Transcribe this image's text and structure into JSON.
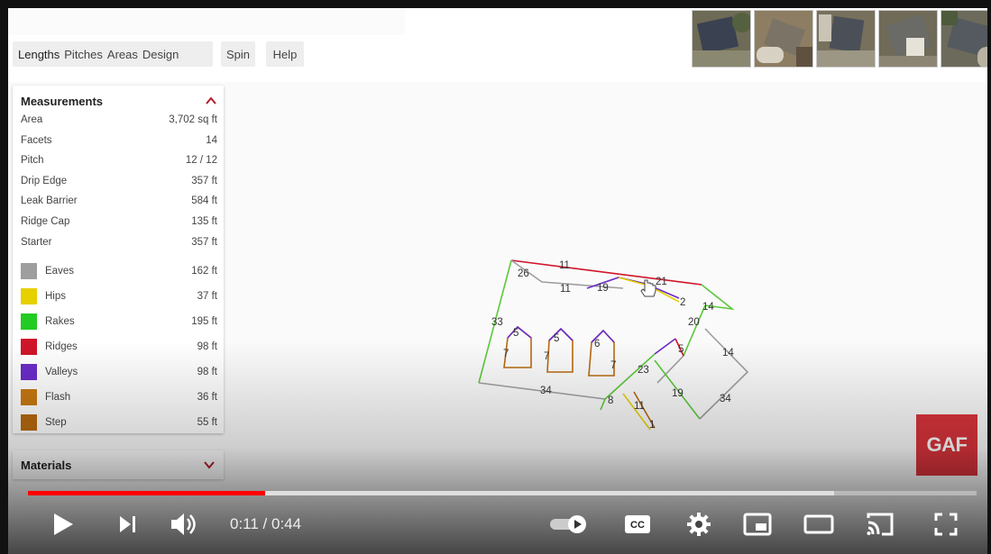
{
  "toolbar": {
    "tabs": [
      "Lengths",
      "Pitches",
      "Areas",
      "Design"
    ],
    "spin_label": "Spin",
    "help_label": "Help"
  },
  "measurements": {
    "title": "Measurements",
    "rows": [
      {
        "label": "Area",
        "value": "3,702 sq ft"
      },
      {
        "label": "Facets",
        "value": "14"
      },
      {
        "label": "Pitch",
        "value": "12 / 12"
      },
      {
        "label": "Drip Edge",
        "value": "357 ft"
      },
      {
        "label": "Leak Barrier",
        "value": "584 ft"
      },
      {
        "label": "Ridge Cap",
        "value": "135 ft"
      },
      {
        "label": "Starter",
        "value": "357 ft"
      }
    ],
    "legend": [
      {
        "label": "Eaves",
        "value": "162 ft",
        "color": "#9e9e9e"
      },
      {
        "label": "Hips",
        "value": "37 ft",
        "color": "#e6d000"
      },
      {
        "label": "Rakes",
        "value": "195 ft",
        "color": "#22cc22"
      },
      {
        "label": "Ridges",
        "value": "98 ft",
        "color": "#d0142a"
      },
      {
        "label": "Valleys",
        "value": "98 ft",
        "color": "#6a2cc8"
      },
      {
        "label": "Flash",
        "value": "36 ft",
        "color": "#c87812"
      },
      {
        "label": "Step",
        "value": "55 ft",
        "color": "#b8690f"
      }
    ]
  },
  "materials": {
    "title": "Materials"
  },
  "brand": {
    "logo_text": "GAF"
  },
  "roof_labels": [
    "11",
    "26",
    "11",
    "19",
    "21",
    "2",
    "14",
    "33",
    "20",
    "5",
    "5",
    "6",
    "7",
    "7",
    "7",
    "5",
    "14",
    "23",
    "34",
    "19",
    "34",
    "8",
    "11",
    "1"
  ],
  "player": {
    "current_time": "0:11",
    "duration": "0:44",
    "time_display": "0:11 / 0:44",
    "played_fraction": 0.25,
    "buffered_fraction": 0.85
  }
}
